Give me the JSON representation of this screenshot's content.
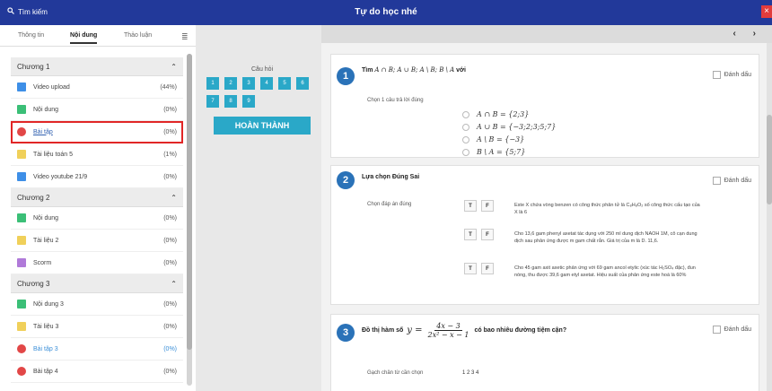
{
  "header": {
    "search_label": "Tìm kiếm",
    "title": "Tự do học nhé",
    "close_icon": "close-icon"
  },
  "sidebar": {
    "tabs": [
      {
        "label": "Thông tin"
      },
      {
        "label": "Nội dung"
      },
      {
        "label": "Thảo luận"
      }
    ],
    "chapters": [
      {
        "title": "Chương 1",
        "items": [
          {
            "label": "Video upload",
            "pct": "(44%)",
            "icon": "video-icon"
          },
          {
            "label": "Nội dung",
            "pct": "(0%)",
            "icon": "document-icon"
          },
          {
            "label": "Bài tập",
            "pct": "(0%)",
            "icon": "exercise-icon"
          },
          {
            "label": "Tài liệu toán 5",
            "pct": "(1%)",
            "icon": "file-icon"
          },
          {
            "label": "Video youtube 21/9",
            "pct": "(0%)",
            "icon": "video-icon"
          }
        ]
      },
      {
        "title": "Chương 2",
        "items": [
          {
            "label": "Nội dung",
            "pct": "(0%)",
            "icon": "document-icon"
          },
          {
            "label": "Tài liệu 2",
            "pct": "(0%)",
            "icon": "file-icon"
          },
          {
            "label": "Scorm",
            "pct": "(0%)",
            "icon": "scorm-icon"
          }
        ]
      },
      {
        "title": "Chương 3",
        "items": [
          {
            "label": "Nội dung 3",
            "pct": "(0%)",
            "icon": "document-icon"
          },
          {
            "label": "Tài liệu 3",
            "pct": "(0%)",
            "icon": "file-icon"
          },
          {
            "label": "Bài tập 3",
            "pct": "(0%)",
            "icon": "exercise-icon"
          },
          {
            "label": "Bài tập 4",
            "pct": "(0%)",
            "icon": "exercise-icon"
          }
        ]
      }
    ]
  },
  "question_nav": {
    "label": "Câu hỏi",
    "numbers": [
      "1",
      "2",
      "3",
      "4",
      "5",
      "6",
      "7",
      "8",
      "9"
    ],
    "finish_label": "HOÀN THÀNH"
  },
  "questions": {
    "q1": {
      "number": "1",
      "prefix": "Tìm",
      "expr": "A ∩ B; A ∪ B; A \\ B; B \\ A",
      "suffix": "với",
      "flag": "Đánh dấu",
      "instruction": "Chọn 1 câu trả lời đúng",
      "options": [
        "A ∩ B = {2;3}",
        "A ∪ B = {−3;2;3;5;7}",
        "A \\ B = {−3}",
        "B \\ A = {5;7}"
      ]
    },
    "q2": {
      "number": "2",
      "title": "Lựa chọn Đúng Sai",
      "flag": "Đánh dấu",
      "instruction": "Chọn đáp án đúng",
      "t_label": "T",
      "f_label": "F",
      "statements": [
        "Este X chứa vòng benzen có công thức phân tử là C₈H₈O₂ số công thức cấu tạo của X là 6",
        "Cho 13,6 gam phenyl axetat tác dụng với 250 ml dung dịch NAOH 1M, cô cạn dung dịch sau phản ứng được m gam chất rắn. Giá trị của m là D. 11,6.",
        "Cho 45 gam axit axetic phản ứng với 69 gam ancol etylic (xúc tác H₂SO₄ đặc), đun nóng, thu được 39,6 gam etyl axetat. Hiệu suất của phản ứng este hoá là 60%"
      ]
    },
    "q3": {
      "number": "3",
      "prefix": "Đồ thị hàm số",
      "y_label": "y =",
      "numerator": "4x − 3",
      "denominator": "2x² − x − 1",
      "suffix": "có bao nhiêu đường tiệm cận?",
      "flag": "Đánh dấu",
      "instruction": "Gạch chân từ cần chọn",
      "answers": "1 2 3 4"
    }
  },
  "colors": {
    "header_bg": "#22399a",
    "accent": "#2aa8c8",
    "selection_outline": "#e12626",
    "question_badge": "#2a72b8"
  }
}
